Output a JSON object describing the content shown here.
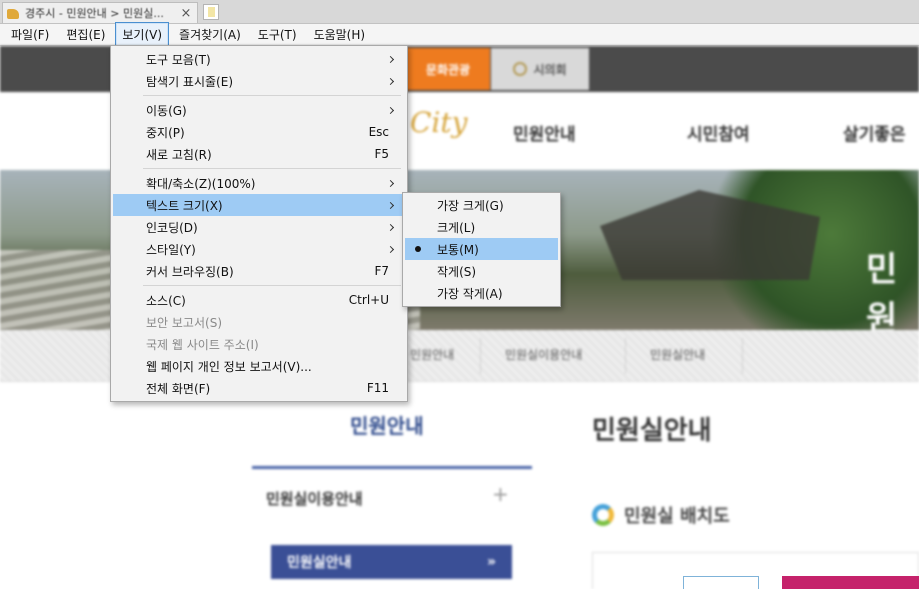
{
  "browser": {
    "tab_title": "경주시 - 민원안내 > 민원실...",
    "tab_close": "×"
  },
  "menubar": {
    "items": [
      "파일(F)",
      "편집(E)",
      "보기(V)",
      "즐겨찾기(A)",
      "도구(T)",
      "도움말(H)"
    ],
    "active_index": 2
  },
  "view_menu": {
    "items": [
      {
        "label": "도구 모음(T)",
        "accel": "",
        "submenu": true,
        "disabled": false
      },
      {
        "label": "탐색기 표시줄(E)",
        "accel": "",
        "submenu": true,
        "disabled": false
      },
      {
        "label": "이동(G)",
        "accel": "",
        "submenu": true,
        "disabled": false
      },
      {
        "label": "중지(P)",
        "accel": "Esc",
        "submenu": false,
        "disabled": false
      },
      {
        "label": "새로 고침(R)",
        "accel": "F5",
        "submenu": false,
        "disabled": false
      },
      {
        "label": "확대/축소(Z)(100%)",
        "accel": "",
        "submenu": true,
        "disabled": false
      },
      {
        "label": "텍스트 크기(X)",
        "accel": "",
        "submenu": true,
        "disabled": false,
        "highlighted": true
      },
      {
        "label": "인코딩(D)",
        "accel": "",
        "submenu": true,
        "disabled": false
      },
      {
        "label": "스타일(Y)",
        "accel": "",
        "submenu": true,
        "disabled": false
      },
      {
        "label": "커서 브라우징(B)",
        "accel": "F7",
        "submenu": false,
        "disabled": false
      },
      {
        "label": "소스(C)",
        "accel": "Ctrl+U",
        "submenu": false,
        "disabled": false
      },
      {
        "label": "보안 보고서(S)",
        "accel": "",
        "submenu": false,
        "disabled": true
      },
      {
        "label": "국제 웹 사이트 주소(I)",
        "accel": "",
        "submenu": false,
        "disabled": true
      },
      {
        "label": "웹 페이지 개인 정보 보고서(V)...",
        "accel": "",
        "submenu": false,
        "disabled": false
      },
      {
        "label": "전체 화면(F)",
        "accel": "F11",
        "submenu": false,
        "disabled": false
      }
    ]
  },
  "text_size_menu": {
    "items": [
      {
        "label": "가장 크게(G)",
        "selected": false
      },
      {
        "label": "크게(L)",
        "selected": false
      },
      {
        "label": "보통(M)",
        "selected": true
      },
      {
        "label": "작게(S)",
        "selected": false
      },
      {
        "label": "가장 작게(A)",
        "selected": false
      }
    ]
  },
  "site": {
    "topnav": {
      "culture": "문화관광",
      "council": "시의회"
    },
    "logo": "City",
    "gnb": [
      "민원안내",
      "시민참여",
      "살기좋은"
    ],
    "hero_text": "민원",
    "subnav": [
      "민원안내",
      "민원실이용안내",
      "민원실안내"
    ],
    "side_title": "민원안내",
    "side_item": "민원실이용안내",
    "side_plus": "+",
    "side_active": "민원실안내",
    "side_active_arrow": "»",
    "main_title": "민원실안내",
    "main_sub": "민원실 배치도"
  }
}
